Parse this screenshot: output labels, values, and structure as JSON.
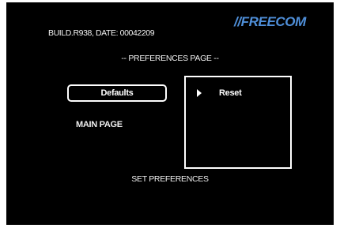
{
  "header": {
    "build_info": "BUILD.R938, DATE: 00042209",
    "brand": "//FREECOM"
  },
  "page_title": "-- PREFERENCES PAGE --",
  "menu": {
    "defaults_label": "Defaults",
    "main_page_label": "MAIN PAGE"
  },
  "options": {
    "items": [
      {
        "icon": "play-arrow-icon",
        "label": "Reset"
      }
    ]
  },
  "footer": {
    "caption": "SET PREFERENCES"
  },
  "colors": {
    "background": "#000000",
    "text": "#ffffff",
    "brand": "#4f8fd9"
  }
}
